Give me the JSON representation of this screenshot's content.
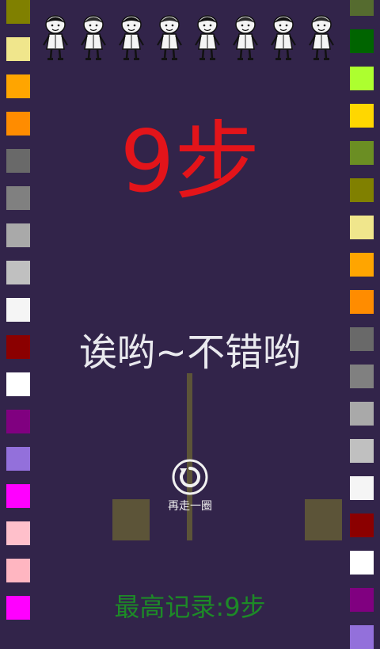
{
  "steps_display": "9步",
  "praise_text": "诶哟~不错哟",
  "replay_label": "再走一圈",
  "best_record": "最高记录:9步",
  "colors": {
    "background": "#32244a",
    "steps": "#e3141a",
    "record": "#1d8a27",
    "track": "#5c5438"
  },
  "left_column_colors": [
    "#808000",
    "#f0e68c",
    "#ffa500",
    "#ff8c00",
    "#696969",
    "#808080",
    "#a9a9a9",
    "#c0c0c0",
    "#f5f5f5",
    "#8b0000",
    "#ffffff",
    "#800080",
    "#9370db",
    "#ff00ff",
    "#ffc0cb",
    "#ffb6c1",
    "#ff00ff"
  ],
  "right_column_colors": [
    "#556b2f",
    "#006400",
    "#adff2f",
    "#ffd700",
    "#6b8e23",
    "#808000",
    "#f0e68c",
    "#ffa500",
    "#ff8c00",
    "#696969",
    "#808080",
    "#a9a9a9",
    "#c0c0c0",
    "#f5f5f5",
    "#8b0000",
    "#ffffff",
    "#800080",
    "#9370db"
  ],
  "characters": [
    "character-hat-boy-icon",
    "character-bag-girl-icon",
    "character-bag-boy-icon",
    "character-braid-girl-icon",
    "character-bald-boy-icon",
    "character-bow-girl-icon",
    "character-ponytail-girl-icon",
    "character-cap-boy-icon"
  ]
}
